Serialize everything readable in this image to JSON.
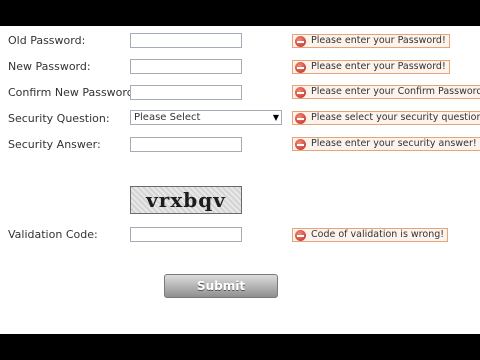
{
  "form": {
    "old_password": {
      "label": "Old Password:",
      "value": "",
      "error": "Please enter your Password!"
    },
    "new_password": {
      "label": "New Password:",
      "value": "",
      "error": "Please enter your Password!"
    },
    "confirm_password": {
      "label": "Confirm New Password:",
      "value": "",
      "error": "Please enter your Confirm Password!"
    },
    "security_question": {
      "label": "Security Question:",
      "selected": "Please Select",
      "error": "Please select your security question!"
    },
    "security_answer": {
      "label": "Security Answer:",
      "value": "",
      "error": "Please enter your security answer!"
    },
    "captcha": {
      "text": "vrxbqv"
    },
    "validation_code": {
      "label": "Validation Code:",
      "value": "",
      "error": "Code of validation is wrong!"
    },
    "submit_label": "Submit"
  },
  "icons": {
    "error": "error-icon",
    "dropdown": "chevron-down-icon"
  },
  "colors": {
    "error_border": "#e7a477",
    "error_background": "#fdf3ec",
    "error_icon": "#c0261b",
    "page_background": "#ffffff",
    "letterbox": "#000000"
  }
}
